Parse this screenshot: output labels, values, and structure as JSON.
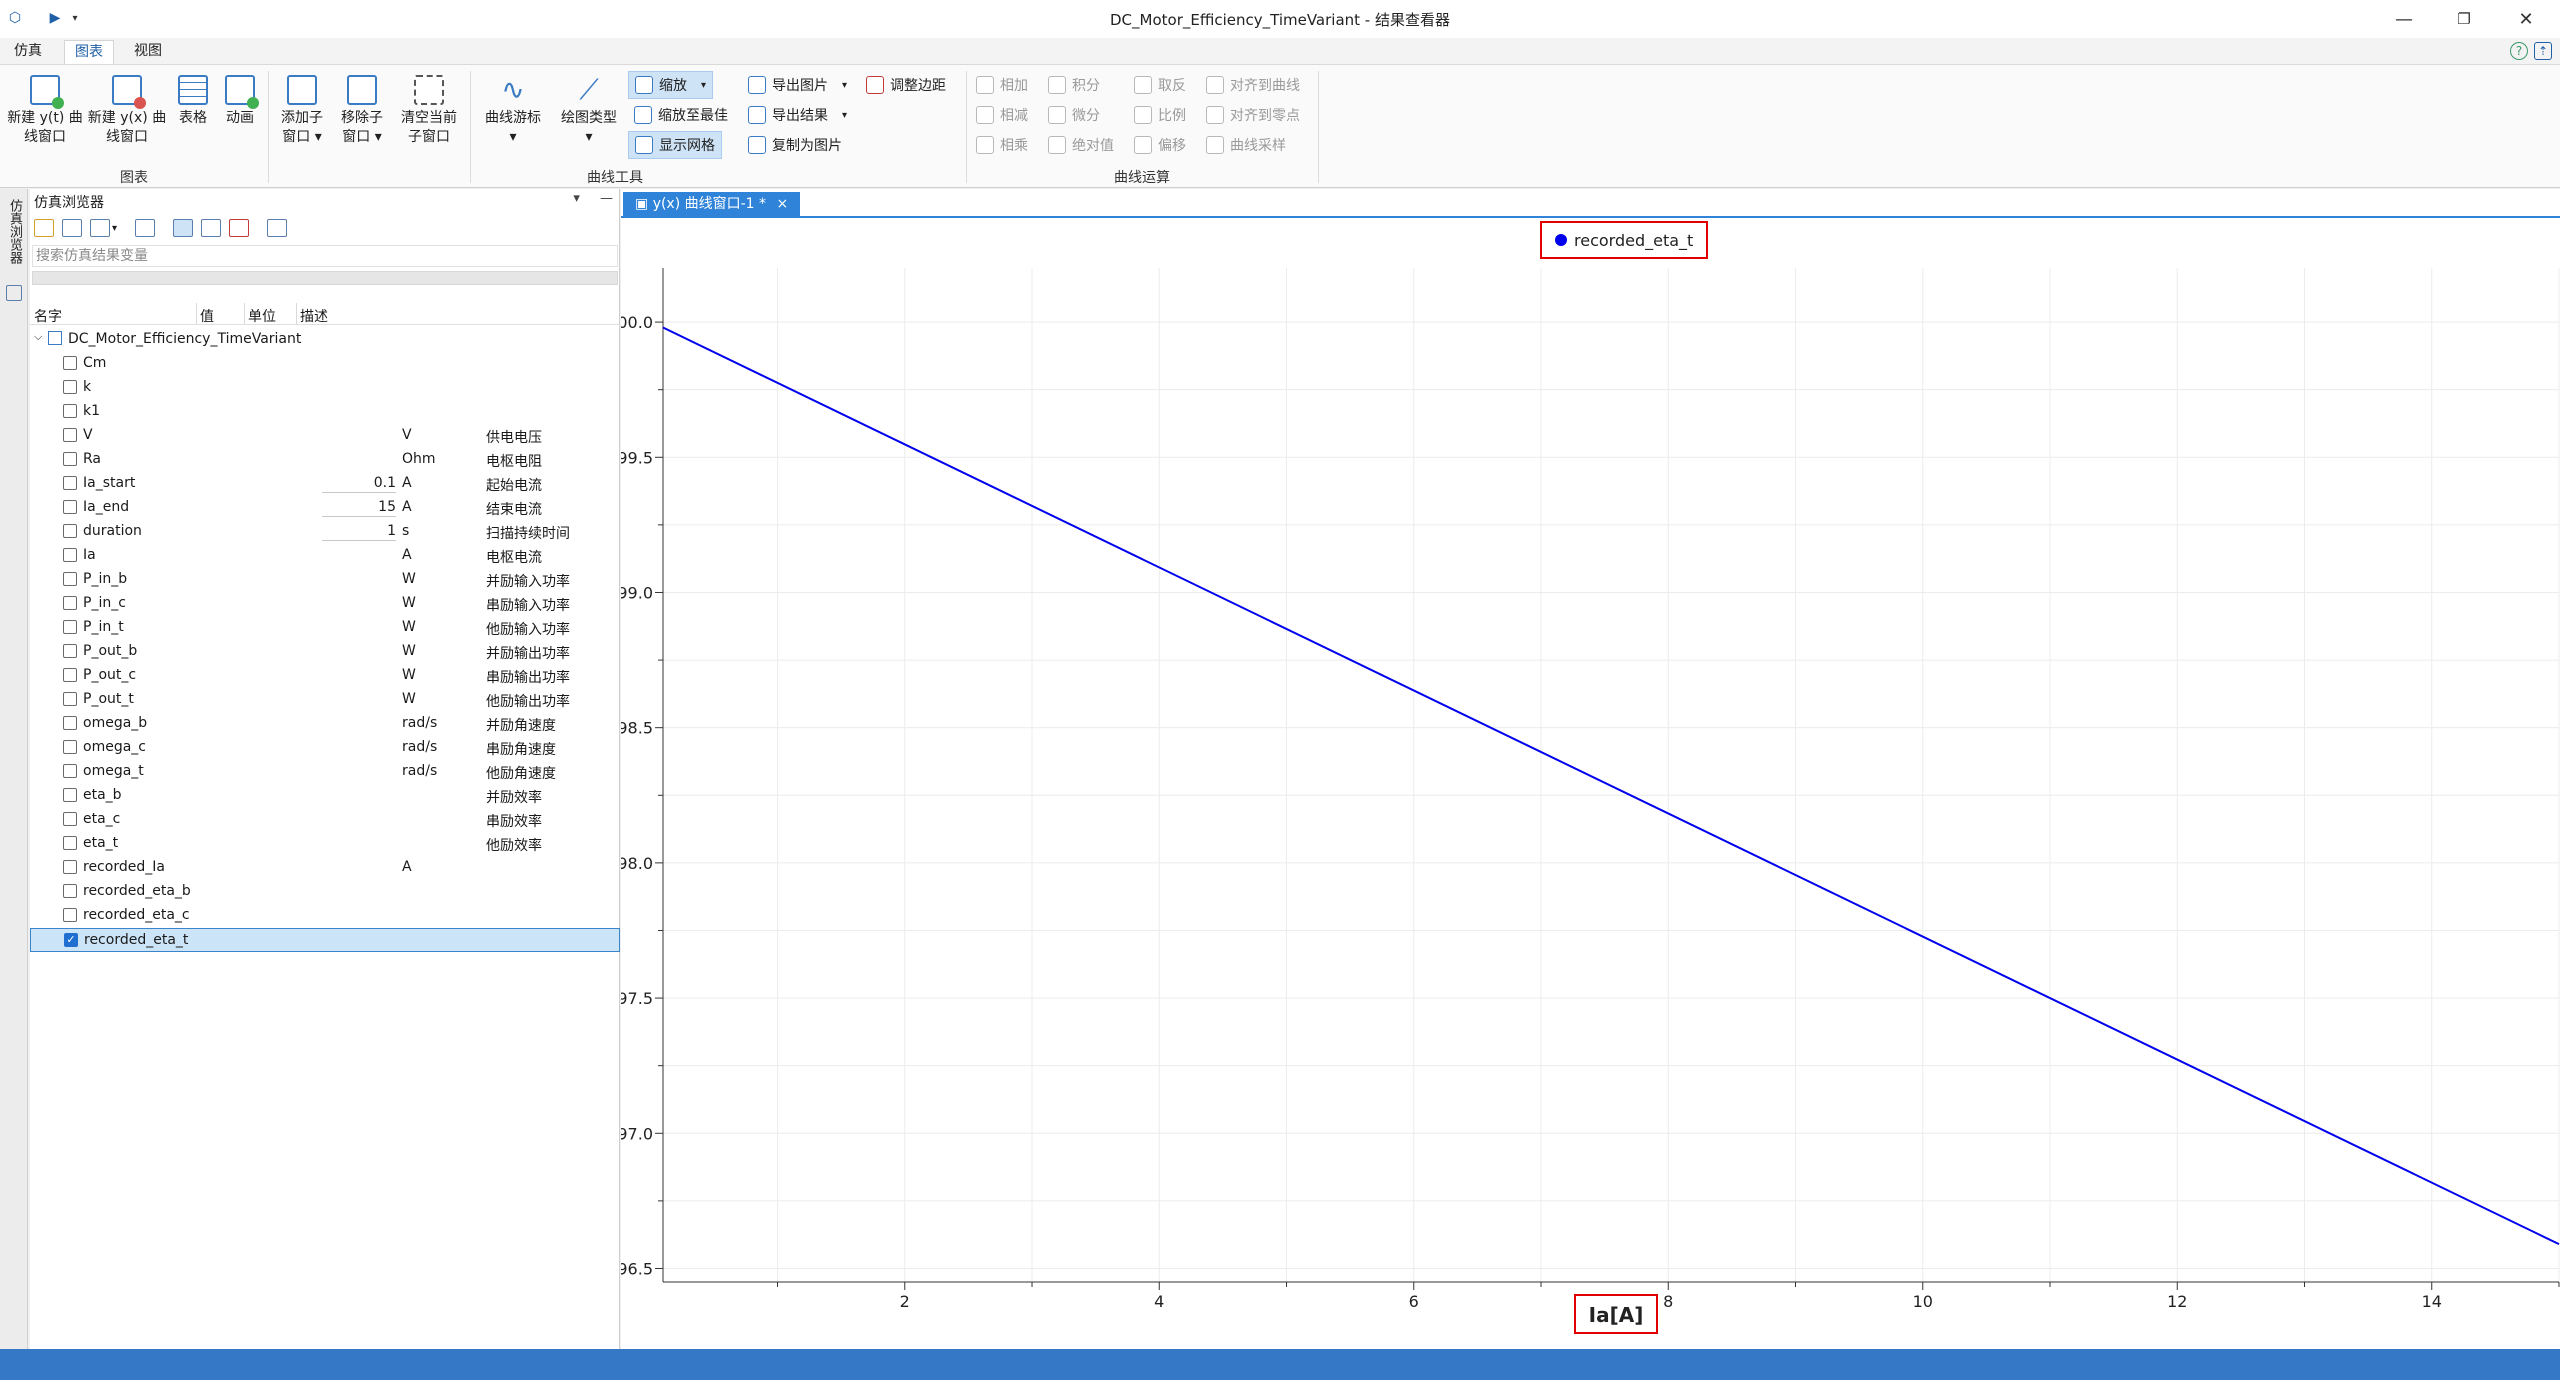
{
  "window": {
    "title": "DC_Motor_Efficiency_TimeVariant - 结果查看器",
    "controls": {
      "minimize": "—",
      "maximize": "❐",
      "close": "✕"
    }
  },
  "menu": {
    "tabs": [
      "仿真",
      "图表",
      "视图"
    ],
    "active_tab": "图表"
  },
  "ribbon": {
    "group_chart": {
      "label": "图表",
      "buttons": [
        "新建 y(t) 曲\n线窗口",
        "新建 y(x) 曲\n线窗口",
        "表格",
        "动画"
      ]
    },
    "group_curve_tools": {
      "label": "曲线工具",
      "big_buttons": [
        "添加子\n窗口 ▾",
        "移除子\n窗口 ▾",
        "清空当前\n子窗口",
        "曲线游标\n▾",
        "绘图类型\n▾"
      ],
      "zoom": "缩放",
      "zoom_best": "缩放至最佳",
      "show_grid": "显示网格",
      "export_image": "导出图片",
      "export_result": "导出结果",
      "copy_image": "复制为图片",
      "adjust_margin": "调整边距"
    },
    "group_curve_ops": {
      "label": "曲线运算",
      "col1": [
        "相加",
        "相减",
        "相乘"
      ],
      "col2": [
        "积分",
        "微分",
        "绝对值"
      ],
      "col3": [
        "取反",
        "比例",
        "偏移"
      ],
      "col4": [
        "对齐到曲线",
        "对齐到零点",
        "曲线采样"
      ]
    }
  },
  "left_strip": {
    "tab_label": "仿真浏览器"
  },
  "browser": {
    "title": "仿真浏览器",
    "pin": "▾",
    "minimize": "—",
    "search_placeholder": "搜索仿真结果变量",
    "columns": {
      "name": "名字",
      "value": "值",
      "unit": "单位",
      "desc": "描述"
    },
    "root": "DC_Motor_Efficiency_TimeVariant",
    "variables": [
      {
        "name": "Cm",
        "value": "",
        "unit": "",
        "desc": ""
      },
      {
        "name": "k",
        "value": "",
        "unit": "",
        "desc": ""
      },
      {
        "name": "k1",
        "value": "",
        "unit": "",
        "desc": ""
      },
      {
        "name": "V",
        "value": "",
        "unit": "V",
        "desc": "供电电压"
      },
      {
        "name": "Ra",
        "value": "",
        "unit": "Ohm",
        "desc": "电枢电阻"
      },
      {
        "name": "Ia_start",
        "value": "0.1",
        "unit": "A",
        "desc": "起始电流"
      },
      {
        "name": "Ia_end",
        "value": "15",
        "unit": "A",
        "desc": "结束电流"
      },
      {
        "name": "duration",
        "value": "1",
        "unit": "s",
        "desc": "扫描持续时间"
      },
      {
        "name": "Ia",
        "value": "",
        "unit": "A",
        "desc": "电枢电流"
      },
      {
        "name": "P_in_b",
        "value": "",
        "unit": "W",
        "desc": "并励输入功率"
      },
      {
        "name": "P_in_c",
        "value": "",
        "unit": "W",
        "desc": "串励输入功率"
      },
      {
        "name": "P_in_t",
        "value": "",
        "unit": "W",
        "desc": "他励输入功率"
      },
      {
        "name": "P_out_b",
        "value": "",
        "unit": "W",
        "desc": "并励输出功率"
      },
      {
        "name": "P_out_c",
        "value": "",
        "unit": "W",
        "desc": "串励输出功率"
      },
      {
        "name": "P_out_t",
        "value": "",
        "unit": "W",
        "desc": "他励输出功率"
      },
      {
        "name": "omega_b",
        "value": "",
        "unit": "rad/s",
        "desc": "并励角速度"
      },
      {
        "name": "omega_c",
        "value": "",
        "unit": "rad/s",
        "desc": "串励角速度"
      },
      {
        "name": "omega_t",
        "value": "",
        "unit": "rad/s",
        "desc": "他励角速度"
      },
      {
        "name": "eta_b",
        "value": "",
        "unit": "",
        "desc": "并励效率"
      },
      {
        "name": "eta_c",
        "value": "",
        "unit": "",
        "desc": "串励效率"
      },
      {
        "name": "eta_t",
        "value": "",
        "unit": "",
        "desc": "他励效率"
      },
      {
        "name": "recorded_Ia",
        "value": "",
        "unit": "A",
        "desc": ""
      },
      {
        "name": "recorded_eta_b",
        "value": "",
        "unit": "",
        "desc": ""
      },
      {
        "name": "recorded_eta_c",
        "value": "",
        "unit": "",
        "desc": ""
      },
      {
        "name": "recorded_eta_t",
        "value": "",
        "unit": "",
        "desc": "",
        "checked": true
      }
    ]
  },
  "document_tab": {
    "label": "y(x) 曲线窗口-1 *",
    "close": "×"
  },
  "chart_data": {
    "type": "line",
    "xlabel": "Ia[A]",
    "ylabel": "",
    "xlim": [
      0.1,
      15
    ],
    "ylim": [
      96.45,
      100.2
    ],
    "xticks": [
      2,
      4,
      6,
      8,
      10,
      12,
      14
    ],
    "yticks": [
      96.5,
      97.0,
      97.5,
      98.0,
      98.5,
      99.0,
      99.5,
      100.0
    ],
    "ytick_labels": [
      "96.5",
      "97.0",
      "97.5",
      "98.0",
      "98.5",
      "99.0",
      "99.5",
      "100.0"
    ],
    "grid": true,
    "legend_position": "top-center",
    "series": [
      {
        "name": "recorded_eta_t",
        "color": "#0000ee",
        "x": [
          0.1,
          15
        ],
        "y": [
          99.98,
          96.59
        ]
      }
    ]
  },
  "colors": {
    "accent": "#2f83d8",
    "status_bar": "#3478c6",
    "series": "#0000ee",
    "highlight_box": "#e00000"
  }
}
